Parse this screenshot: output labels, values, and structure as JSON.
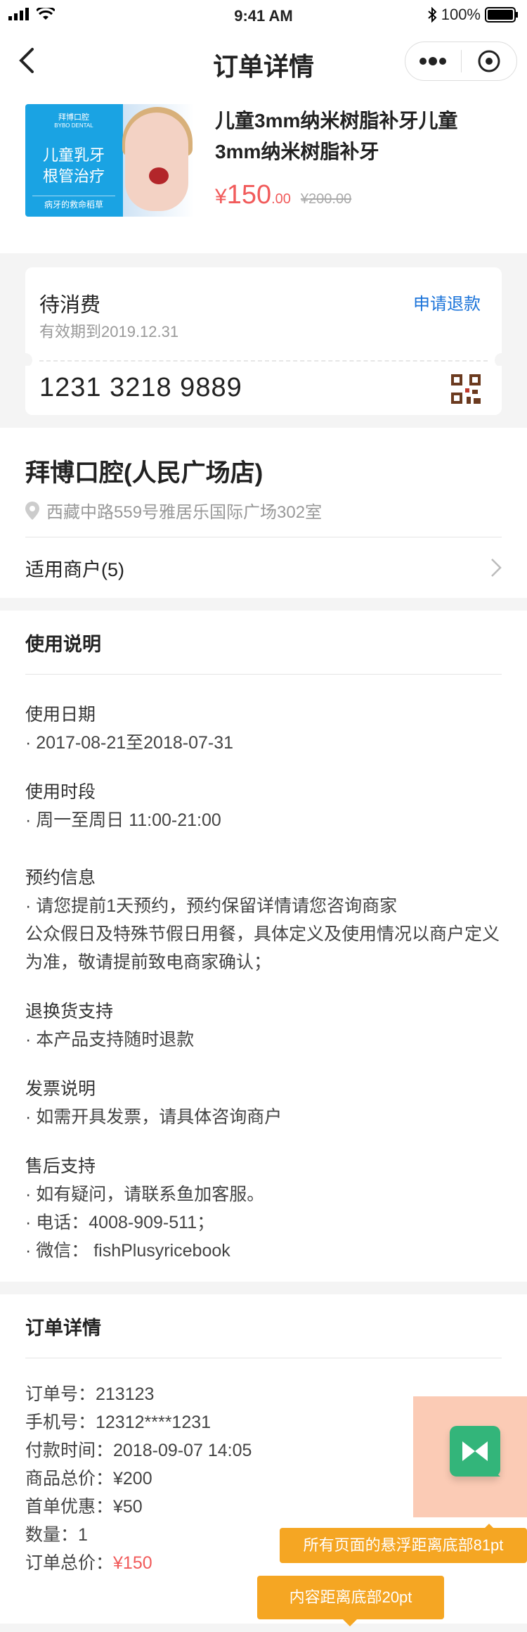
{
  "status_bar": {
    "time": "9:41 AM",
    "battery": "100%"
  },
  "nav": {
    "title": "订单详情"
  },
  "product": {
    "thumb": {
      "brand_cn": "拜博口腔",
      "brand_en": "BYBO DENTAL",
      "line1": "儿童乳牙",
      "line2": "根管治疗",
      "slogan": "病牙的救命稻草"
    },
    "title": "儿童3mm纳米树脂补牙儿童3mm纳米树脂补牙",
    "price_symbol": "¥",
    "price_int": "150",
    "price_dec": ".00",
    "old_price": "¥200.00"
  },
  "ticket": {
    "status": "待消费",
    "valid_until": "有效期到2019.12.31",
    "refund_label": "申请退款",
    "code": "1231 3218 9889"
  },
  "store": {
    "name": "拜博口腔(人民广场店)",
    "address": "西藏中路559号雅居乐国际广场302室",
    "merchants_label": "适用商户(5)"
  },
  "usage": {
    "title": "使用说明",
    "blocks": [
      {
        "heading": "使用日期",
        "lines": [
          "· 2017-08-21至2018-07-31"
        ]
      },
      {
        "heading": "使用时段",
        "lines": [
          "· 周一至周日 11:00-21:00"
        ]
      },
      {
        "heading": "预约信息",
        "lines": [
          "· 请您提前1天预约，预约保留详情请您咨询商家",
          "公众假日及特殊节假日用餐，具体定义及使用情况以商户定义为准，敬请提前致电商家确认；"
        ]
      },
      {
        "heading": "退换货支持",
        "lines": [
          "· 本产品支持随时退款"
        ]
      },
      {
        "heading": "发票说明",
        "lines": [
          "· 如需开具发票，请具体咨询商户"
        ]
      },
      {
        "heading": "售后支持",
        "lines": [
          "· 如有疑问，请联系鱼加客服。",
          "· 电话：4008-909-511；",
          "· 微信： fishPlusyricebook"
        ]
      }
    ]
  },
  "order": {
    "title": "订单详情",
    "order_no": "订单号：213123",
    "phone": "手机号：12312****1231",
    "pay_time": "付款时间：2018-09-07 14:05",
    "total": "商品总价：¥200",
    "discount": "首单优惠：¥50",
    "qty": "数量：1",
    "order_total_label": "订单总价：",
    "order_total_value": "¥150"
  },
  "annotations": {
    "float_note": "所有页面的悬浮距离底部81pt",
    "content_note": "内容距离底部20pt"
  },
  "colors": {
    "accent_blue": "#1a73d9",
    "price_red": "#f15b5b",
    "float_green": "#33b57a",
    "note_orange": "#f5a623"
  }
}
